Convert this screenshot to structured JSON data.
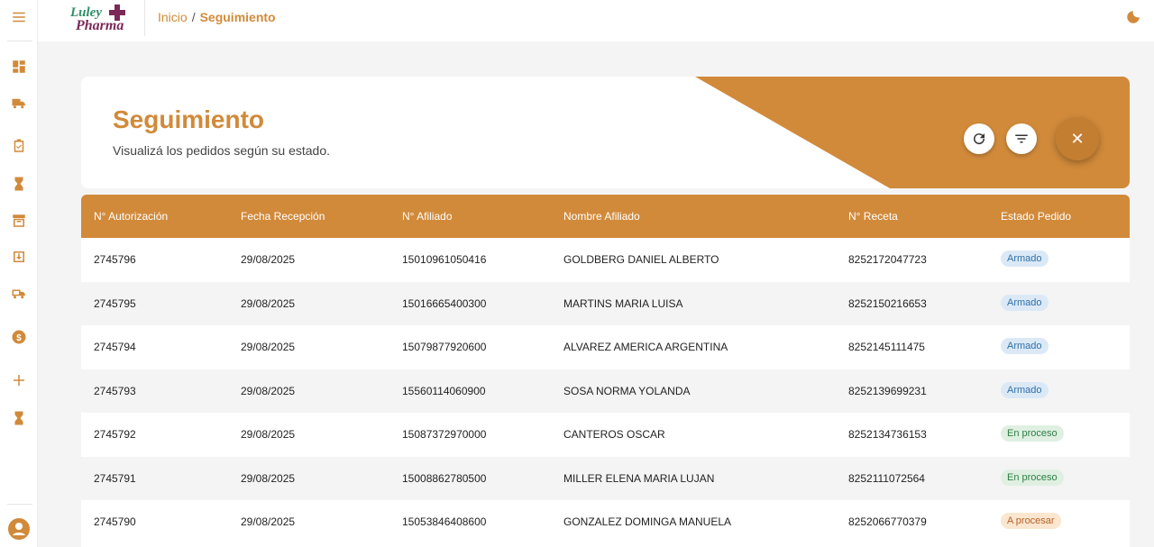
{
  "app": {
    "brand_line1": "Luley",
    "brand_line2": "Pharma"
  },
  "breadcrumb": {
    "home": "Inicio",
    "separator": "/",
    "current": "Seguimiento"
  },
  "header": {
    "title": "Seguimiento",
    "subtitle": "Visualizá los pedidos según su estado.",
    "close_symbol": "✕"
  },
  "sidebar_icons": [
    "menu-icon",
    "dashboard-icon",
    "truck-icon",
    "checklist-icon",
    "hourglass-icon",
    "archive-icon",
    "download-box-icon",
    "delivery-truck-icon",
    "dollar-icon",
    "plus-icon",
    "hourglass-icon",
    "user-avatar-icon"
  ],
  "table": {
    "columns": [
      "N° Autorización",
      "Fecha Recepción",
      "N° Afiliado",
      "Nombre Afiliado",
      "N° Receta",
      "Estado Pedido"
    ],
    "rows": [
      {
        "auth": "2745796",
        "date": "29/08/2025",
        "affiliate": "15010961050416",
        "name": "GOLDBERG DANIEL ALBERTO",
        "recipe": "8252172047723",
        "status": "Armado"
      },
      {
        "auth": "2745795",
        "date": "29/08/2025",
        "affiliate": "15016665400300",
        "name": "MARTINS MARIA LUISA",
        "recipe": "8252150216653",
        "status": "Armado"
      },
      {
        "auth": "2745794",
        "date": "29/08/2025",
        "affiliate": "15079877920600",
        "name": "ALVAREZ AMERICA ARGENTINA",
        "recipe": "8252145111475",
        "status": "Armado"
      },
      {
        "auth": "2745793",
        "date": "29/08/2025",
        "affiliate": "15560114060900",
        "name": "SOSA NORMA YOLANDA",
        "recipe": "8252139699231",
        "status": "Armado"
      },
      {
        "auth": "2745792",
        "date": "29/08/2025",
        "affiliate": "15087372970000",
        "name": "CANTEROS OSCAR",
        "recipe": "8252134736153",
        "status": "En proceso"
      },
      {
        "auth": "2745791",
        "date": "29/08/2025",
        "affiliate": "15008862780500",
        "name": "MILLER ELENA MARIA LUJAN",
        "recipe": "8252111072564",
        "status": "En proceso"
      },
      {
        "auth": "2745790",
        "date": "29/08/2025",
        "affiliate": "15053846408600",
        "name": "GONZALEZ DOMINGA MANUELA",
        "recipe": "8252066770379",
        "status": "A procesar"
      }
    ]
  },
  "colors": {
    "accent": "#d18a3a",
    "status_armado_bg": "#dbe9f7",
    "status_armado_fg": "#2f6fa8",
    "status_proceso_bg": "#dff0e2",
    "status_proceso_fg": "#2f7d43",
    "status_procesar_bg": "#fbe6cf",
    "status_procesar_fg": "#b4622a"
  }
}
